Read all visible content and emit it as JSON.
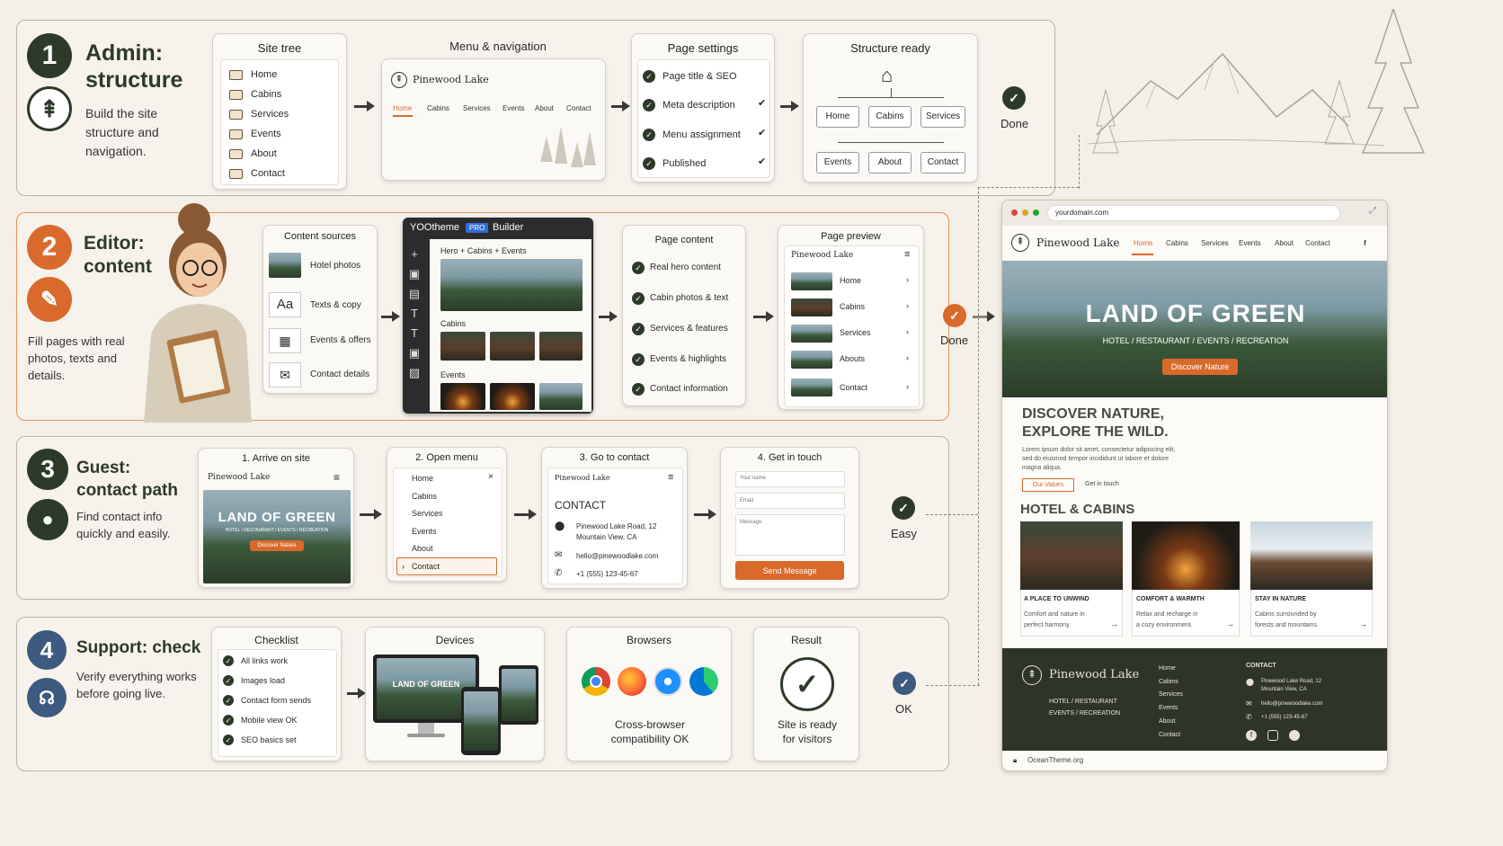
{
  "rows": [
    {
      "num": "1",
      "title": "Admin:",
      "title2": "structure",
      "desc": [
        "Build the site",
        "structure and",
        "navigation."
      ]
    },
    {
      "num": "2",
      "title": "Editor:",
      "title2": "content",
      "desc": [
        "Fill pages with real",
        "photos, texts and",
        "details."
      ]
    },
    {
      "num": "3",
      "title": "Guest:",
      "title2": "contact path",
      "desc": [
        "Find contact info",
        "quickly and easily."
      ]
    },
    {
      "num": "4",
      "title": "Support: check",
      "title2": "",
      "desc": [
        "Verify everything works",
        "before going live."
      ]
    }
  ],
  "site_tree": {
    "title": "Site tree",
    "items": [
      "Home",
      "Cabins",
      "Services",
      "Events",
      "About",
      "Contact"
    ]
  },
  "menu_nav": {
    "title": "Menu & navigation",
    "brand": "Pinewood Lake",
    "items": [
      "Home",
      "Cabins",
      "Services",
      "Events",
      "About",
      "Contact"
    ]
  },
  "page_settings": {
    "title": "Page settings",
    "items": [
      "Page title & SEO",
      "Meta description",
      "Menu assignment",
      "Published"
    ]
  },
  "structure": {
    "title": "Structure ready",
    "top": [
      "Home",
      "Cabins",
      "Services"
    ],
    "bottom": [
      "Events",
      "About",
      "Contact"
    ]
  },
  "done1": "Done",
  "content_sources": {
    "title": "Content sources",
    "items": [
      "Hotel photos",
      "Texts & copy",
      "Events & offers",
      "Contact details"
    ],
    "aa": "Aa"
  },
  "builder": {
    "name": "YOOtheme",
    "pro": "PRO",
    "label": "Builder",
    "section1": "Hero + Cabins + Events",
    "section2": "Cabins",
    "section3": "Events"
  },
  "page_content": {
    "title": "Page content",
    "items": [
      "Real hero content",
      "Cabin photos & text",
      "Services & features",
      "Events & highlights",
      "Contact information"
    ]
  },
  "page_preview": {
    "title": "Page preview",
    "brand": "Pinewood Lake",
    "items": [
      "Home",
      "Cabins",
      "Services",
      "Abouts",
      "Contact"
    ]
  },
  "done2": "Done",
  "guest": {
    "s1": {
      "title": "1. Arrive on site",
      "brand": "Pinewood Lake",
      "hero": "LAND OF GREEN",
      "sub": "HOTEL / RESTAURANT / EVENTS / RECREATION",
      "btn": "Discover Nature"
    },
    "s2": {
      "title": "2. Open menu",
      "items": [
        "Home",
        "Cabins",
        "Services",
        "Events",
        "About",
        "Contact"
      ]
    },
    "s3": {
      "title": "3. Go to contact",
      "brand": "Pinewood Lake",
      "heading": "CONTACT",
      "addr1": "Pinewood Lake Road, 12",
      "addr2": "Mountain View, CA",
      "email": "hello@pinewoodlake.com",
      "phone": "+1 (555) 123-45-67"
    },
    "s4": {
      "title": "4. Get in touch",
      "f1": "Your name",
      "f2": "Email",
      "f3": "Message",
      "btn": "Send Message"
    }
  },
  "easy": "Easy",
  "checklist": {
    "title": "Checklist",
    "items": [
      "All links work",
      "Images load",
      "Contact form sends",
      "Mobile view OK",
      "SEO basics set"
    ]
  },
  "devices": {
    "title": "Devices",
    "hero": "LAND OF GREEN"
  },
  "browsers": {
    "title": "Browsers",
    "caption1": "Cross-browser",
    "caption2": "compatibility OK"
  },
  "result": {
    "title": "Result",
    "caption1": "Site is ready",
    "caption2": "for visitors"
  },
  "ok": "OK",
  "site": {
    "url": "yourdomain.com",
    "brand": "Pinewood Lake",
    "nav": [
      "Home",
      "Cabins",
      "Services",
      "Events",
      "About",
      "Contact"
    ],
    "social": "f",
    "hero": "LAND OF GREEN",
    "hero_sub": "HOTEL / RESTAURANT / EVENTS / RECREATION",
    "hero_btn": "Discover Nature",
    "h2a": "DISCOVER NATURE,",
    "h2b": "EXPLORE THE WILD.",
    "lorem1": "Lorem ipsum dolor sit amet, consectetur adipiscing elit,",
    "lorem2": "sed do eiusmod tempor incididunt ut labore et dolore",
    "lorem3": "magna aliqua.",
    "btn1": "Our Values",
    "btn2": "Get in touch",
    "h3": "HOTEL & CABINS",
    "cards": [
      {
        "title": "A PLACE TO UNWIND",
        "l1": "Comfort and nature in",
        "l2": "perfect harmony."
      },
      {
        "title": "COMFORT & WARMTH",
        "l1": "Relax and recharge in",
        "l2": "a cozy environment."
      },
      {
        "title": "STAY IN NATURE",
        "l1": "Cabins surrounded by",
        "l2": "forests and mountains."
      }
    ],
    "footer": {
      "brand": "Pinewood Lake",
      "tag1": "HOTEL / RESTAURANT",
      "tag2": "EVENTS / RECREATION",
      "links": [
        "Home",
        "Cabins",
        "Services",
        "Events",
        "About",
        "Contact"
      ],
      "contact_h": "CONTACT",
      "addr1": "Pinewood Lake Road, 12",
      "addr2": "Mountain View, CA",
      "email": "hello@pinewoodlake.com",
      "phone": "+1 (555) 123-45-67"
    },
    "bottom": "OceanTheme.org"
  },
  "colors": {
    "dark": "#2d3a2a",
    "orange": "#d96a2b",
    "blue": "#3d5a80"
  }
}
